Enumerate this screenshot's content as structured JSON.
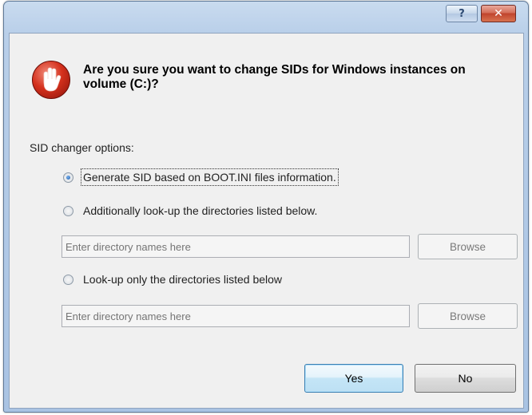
{
  "titlebar": {
    "help_icon": "help-icon",
    "help_glyph": "?",
    "close_icon": "close-icon",
    "close_glyph": "✕"
  },
  "logo": {
    "icon": "app-logo-icon",
    "color": "#d5311d"
  },
  "question": "Are you sure you want to change SIDs for Windows instances on volume (C:)?",
  "options": {
    "section_label": "SID changer options:",
    "radio_boot_ini": {
      "label": "Generate SID based on BOOT.INI files information.",
      "checked": true
    },
    "radio_additional": {
      "label": "Additionally look-up the directories listed below.",
      "checked": false
    },
    "additional_input": {
      "placeholder": "Enter directory names here",
      "value": ""
    },
    "additional_browse": "Browse",
    "radio_only": {
      "label": "Look-up only the directories listed below",
      "checked": false
    },
    "only_input": {
      "placeholder": "Enter directory names here",
      "value": ""
    },
    "only_browse": "Browse"
  },
  "footer": {
    "yes_label": "Yes",
    "no_label": "No"
  },
  "colors": {
    "accent": "#3c7fb1",
    "title_gradient": "#b9cfe9",
    "close": "#c0432d"
  }
}
